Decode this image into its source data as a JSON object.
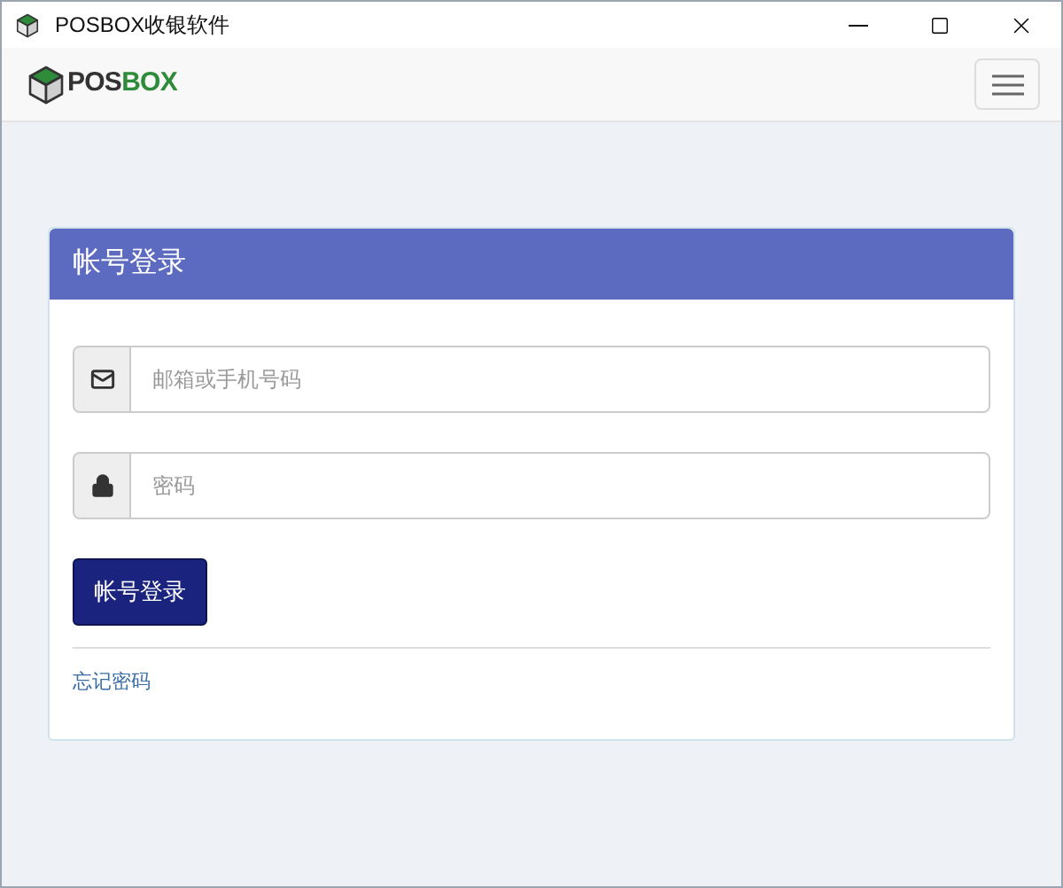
{
  "window": {
    "title": "POSBOX收银软件"
  },
  "navbar": {
    "logo": {
      "prefix": "POS",
      "suffix": "BOX"
    }
  },
  "login": {
    "title": "帐号登录",
    "fields": [
      {
        "kind": "email",
        "placeholder": "邮箱或手机号码"
      },
      {
        "kind": "password",
        "placeholder": "密码"
      }
    ],
    "submit": "帐号登录",
    "forgot": "忘记密码"
  }
}
